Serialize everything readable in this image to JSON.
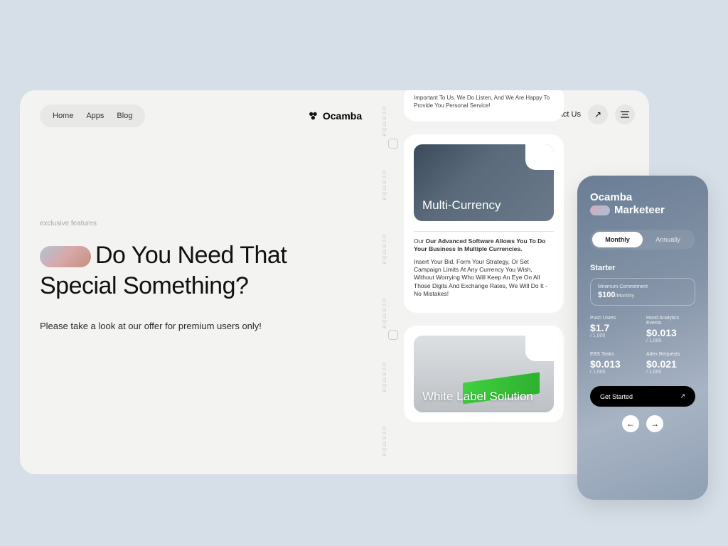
{
  "nav": {
    "items": [
      "Home",
      "Apps",
      "Blog"
    ]
  },
  "brand": "Ocamba",
  "contact": "Contact Us",
  "vertical_word": "ocamba",
  "hero": {
    "eyebrow": "exclusive features",
    "headline_1": "Do You Need That",
    "headline_2": "Special Something?",
    "sub": "Please take a look at our offer for premium users only!"
  },
  "top_card": {
    "text": "Important To Us. We Do Listen, And We Are Happy To Provide You Personal Service!"
  },
  "multi_card": {
    "title": "Multi-Currency",
    "lead": "Our Advanced Software Allows You To Do Your Business In Multiple Currencies.",
    "body": "Insert Your Bid, Form Your Strategy, Or Set Campaign Limits At Any Currency You Wish, Without Worrying Who Will Keep An Eye On All Those Digits And Exchange Rates, We Will Do It - No Mistakes!"
  },
  "white_card": {
    "title": "White Label Solution"
  },
  "phone": {
    "brand1": "Ocamba",
    "brand2": "Marketeer",
    "toggle": {
      "monthly": "Monthly",
      "annually": "Annually"
    },
    "plan": "Starter",
    "commit_label": "Minimum Commitment",
    "commit_value": "$100",
    "commit_per": "/Monthly",
    "metrics": [
      {
        "label": "Push Users",
        "value": "$1.7",
        "per": "/ 1,000"
      },
      {
        "label": "Hood Analytics Events",
        "value": "$0.013",
        "per": "/ 1,000"
      },
      {
        "label": "EBS Tasks",
        "value": "$0.013",
        "per": "/ 1,000"
      },
      {
        "label": "Adex Requests",
        "value": "$0.021",
        "per": "/ 1,000"
      }
    ],
    "cta": "Get Started"
  }
}
